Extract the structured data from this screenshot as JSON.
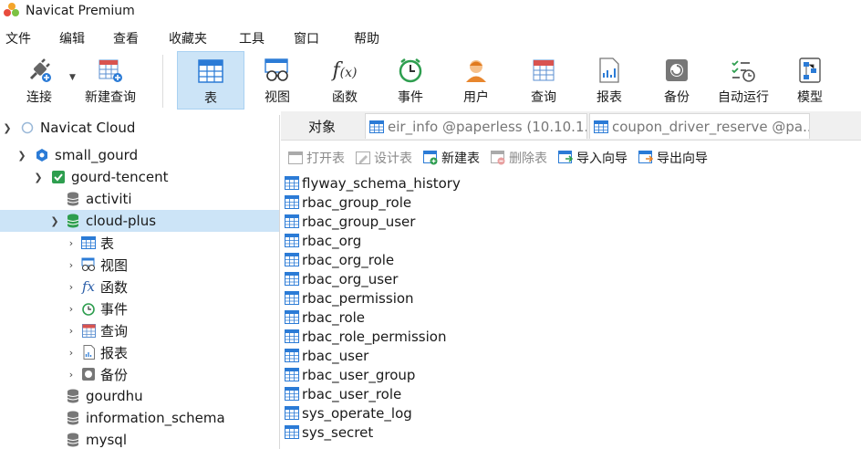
{
  "window": {
    "title": "Navicat Premium"
  },
  "menu": [
    "文件",
    "编辑",
    "查看",
    "收藏夹",
    "工具",
    "窗口",
    "帮助"
  ],
  "toolbar": {
    "connect": "连接",
    "new_query": "新建查询",
    "items": [
      "表",
      "视图",
      "函数",
      "事件",
      "用户",
      "查询",
      "报表",
      "备份",
      "自动运行",
      "模型"
    ],
    "active": "表"
  },
  "tree": {
    "root": "Navicat Cloud",
    "project": "small_gourd",
    "connection": "gourd-tencent",
    "databases": [
      "activiti",
      "cloud-plus",
      "gourdhu",
      "information_schema",
      "mysql"
    ],
    "selected_db": "cloud-plus",
    "db_children": [
      "表",
      "视图",
      "函数",
      "事件",
      "查询",
      "报表",
      "备份"
    ]
  },
  "tabs": {
    "objects": "对象",
    "open": [
      "eir_info @paperless (10.10.1...",
      "coupon_driver_reserve @pa..."
    ]
  },
  "object_toolbar": {
    "open_table": "打开表",
    "design_table": "设计表",
    "new_table": "新建表",
    "delete_table": "删除表",
    "import_wizard": "导入向导",
    "export_wizard": "导出向导"
  },
  "tables": [
    "flyway_schema_history",
    "rbac_group_role",
    "rbac_group_user",
    "rbac_org",
    "rbac_org_role",
    "rbac_org_user",
    "rbac_permission",
    "rbac_role",
    "rbac_role_permission",
    "rbac_user",
    "rbac_user_group",
    "rbac_user_role",
    "sys_operate_log",
    "sys_secret"
  ],
  "colors": {
    "selection": "#cce4f7",
    "accent_blue": "#2b7bd6",
    "db_green": "#2e9e4f"
  }
}
